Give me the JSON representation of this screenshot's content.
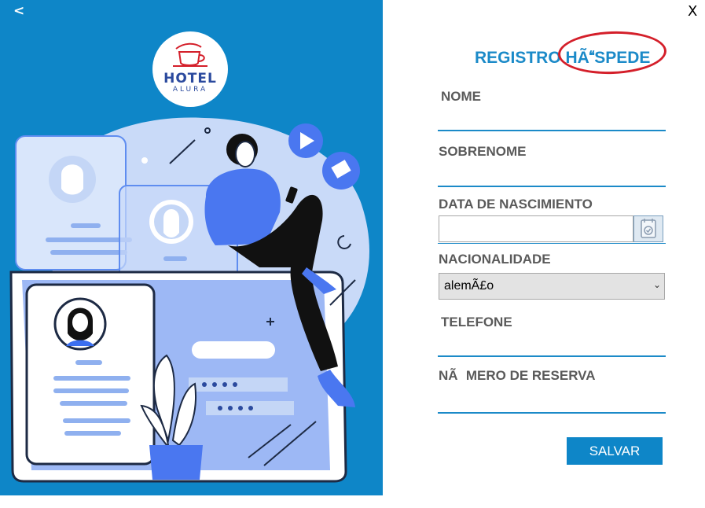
{
  "nav": {
    "back_label": "<",
    "close_label": "X"
  },
  "logo": {
    "line1": "HOTEL",
    "line2": "ALURA"
  },
  "form": {
    "title": "REGISTRO HÃSPEDE",
    "nome_label": "NOME",
    "sobrenome_label": "SOBRENOME",
    "data_label": "DATA DE NASCIMIENTO",
    "nacionalidade_label": "NACIONALIDADE",
    "nacionalidade_value": "alemÃ£o",
    "telefone_label": "TELEFONE",
    "reserva_label": "NÃMERO DE RESERVA",
    "save_label": "SALVAR"
  },
  "colors": {
    "brand_blue": "#0e86c8",
    "title_blue": "#1b8ac8",
    "annotation_red": "#d41f2a",
    "label_gray": "#5a5a5a"
  }
}
